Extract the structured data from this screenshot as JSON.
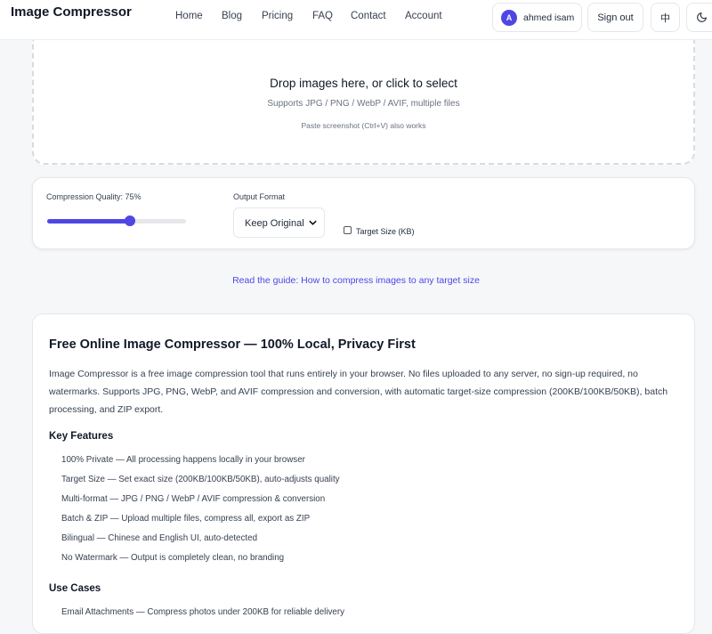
{
  "header": {
    "brand": "Image Compressor",
    "nav": [
      "Home",
      "Blog",
      "Pricing",
      "FAQ",
      "Contact",
      "Account"
    ],
    "user": {
      "initial": "A",
      "name": "ahmed isam"
    },
    "sign_out": "Sign out",
    "lang_toggle": "中",
    "theme_icon": "moon-icon"
  },
  "dropzone": {
    "title": "Drop images here, or click to select",
    "subtitle": "Supports JPG / PNG / WebP / AVIF, multiple files",
    "paste_hint": "Paste screenshot (Ctrl+V) also works"
  },
  "options": {
    "quality_label": "Compression Quality: 75%",
    "quality_value": 75,
    "format_label": "Output Format",
    "format_selected": "Keep Original",
    "target_size_label": "Target Size (KB)",
    "target_size_checked": false
  },
  "guide_link": "Read the guide: How to compress images to any target size",
  "colors": {
    "accent": "#4f46e5"
  },
  "content": {
    "title": "Free Online Image Compressor — 100% Local, Privacy First",
    "intro": "Image Compressor is a free image compression tool that runs entirely in your browser. No files uploaded to any server, no sign-up required, no watermarks. Supports JPG, PNG, WebP, and AVIF compression and conversion, with automatic target-size compression (200KB/100KB/50KB), batch processing, and ZIP export.",
    "features_heading": "Key Features",
    "features": [
      "100% Private — All processing happens locally in your browser",
      "Target Size — Set exact size (200KB/100KB/50KB), auto-adjusts quality",
      "Multi-format — JPG / PNG / WebP / AVIF compression & conversion",
      "Batch & ZIP — Upload multiple files, compress all, export as ZIP",
      "Bilingual — Chinese and English UI, auto-detected",
      "No Watermark — Output is completely clean, no branding"
    ],
    "use_cases_heading": "Use Cases",
    "use_cases": [
      "Email Attachments — Compress photos under 200KB for reliable delivery"
    ]
  }
}
